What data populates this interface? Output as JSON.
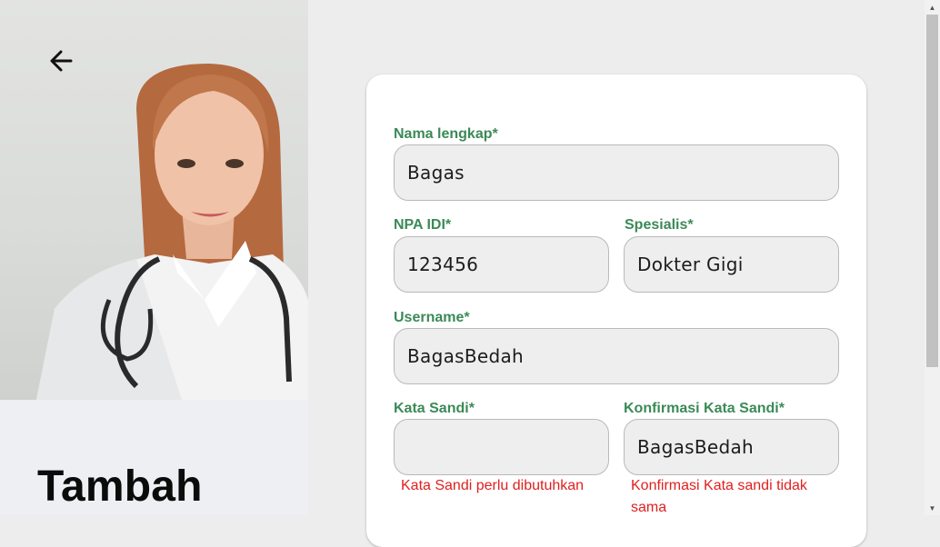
{
  "left": {
    "heading": "Tambah"
  },
  "form": {
    "nama": {
      "label": "Nama lengkap*",
      "value": "Bagas"
    },
    "npa": {
      "label": "NPA IDI*",
      "value": "123456"
    },
    "spesialis": {
      "label": "Spesialis*",
      "value": "Dokter Gigi"
    },
    "username": {
      "label": "Username*",
      "value": "BagasBedah"
    },
    "kata_sandi": {
      "label": "Kata Sandi*",
      "value": "",
      "error": "Kata Sandi perlu dibutuhkan"
    },
    "konfirmasi": {
      "label": "Konfirmasi Kata Sandi*",
      "value": "BagasBedah",
      "error_line1": "Konfirmasi Kata sandi tidak",
      "error_line2": "sama"
    }
  },
  "colors": {
    "label_green": "#3b8a57",
    "error_red": "#e02020"
  },
  "icons": {
    "back": "arrow-left-icon",
    "scroll_up": "triangle-up",
    "scroll_down": "triangle-down"
  }
}
